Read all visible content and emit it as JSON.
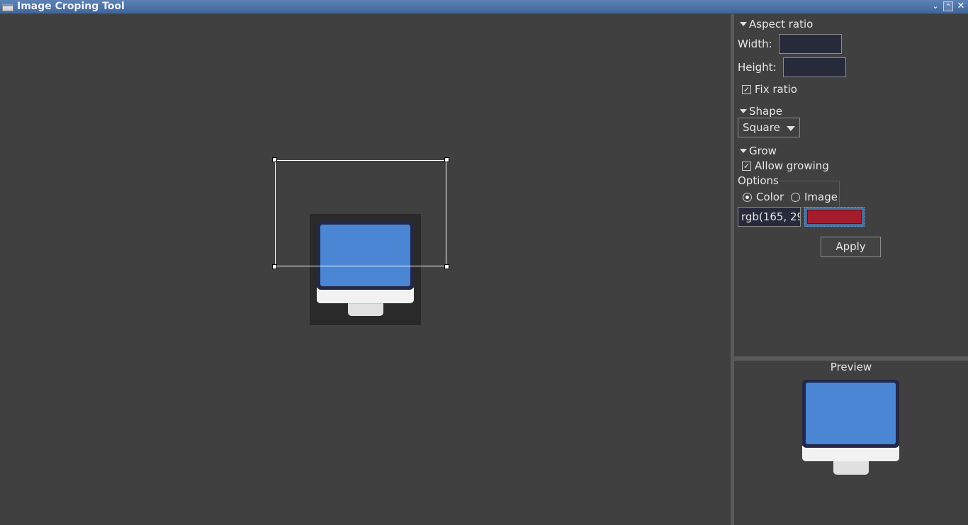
{
  "window": {
    "title": "Image Croping Tool",
    "controls": [
      "minimize",
      "maximize",
      "close"
    ]
  },
  "canvas": {
    "image_icon": "monitor-icon",
    "image_colors": {
      "screen": "#4a86d4",
      "bezel": "#23284a",
      "base": "#f1f1f1"
    }
  },
  "panel": {
    "aspect_ratio": {
      "heading": "Aspect ratio",
      "width_label": "Width:",
      "width_value": "",
      "height_label": "Height:",
      "height_value": "",
      "fix_ratio_label": "Fix ratio",
      "fix_ratio_checked": true
    },
    "shape": {
      "heading": "Shape",
      "selected": "Square"
    },
    "grow": {
      "heading": "Grow",
      "allow_label": "Allow growing",
      "allow_checked": true,
      "options_label": "Options",
      "radio_color": "Color",
      "radio_image": "Image",
      "selected": "Color",
      "color_text": "rgb(165, 29",
      "color_hex": "#a51d2d"
    },
    "apply_label": "Apply"
  },
  "preview": {
    "title": "Preview"
  }
}
